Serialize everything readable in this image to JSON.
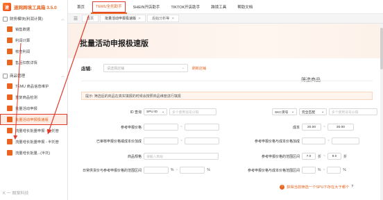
{
  "app": {
    "title": "速网跨境工具箱 3.5.0",
    "logo_char": "速"
  },
  "sidebar": {
    "groups": [
      {
        "label": "财务模块(利润计算)",
        "items": [
          {
            "label": "销售数据"
          },
          {
            "label": "利润计算"
          },
          {
            "label": "核查利润"
          },
          {
            "label": "售后扣款详情"
          }
        ]
      },
      {
        "label": "商品管理",
        "items": [
          {
            "label": "TEMU 商品信息维护"
          },
          {
            "label": "重复商品检测"
          },
          {
            "label": "批量活动申报"
          },
          {
            "label": "批量活动申报极速版",
            "active": true
          },
          {
            "label": "流量增长批量申报 - 全托管"
          },
          {
            "label": "流量增长批量申报 - 半托管"
          },
          {
            "label": "流量增长批量...(半托)"
          }
        ]
      }
    ],
    "footer": "K 一 图案科技"
  },
  "topnav": {
    "tabs": [
      {
        "label": "首页"
      },
      {
        "label": "TEMU全托助手",
        "active": true
      },
      {
        "label": "SHEIN开店助手"
      },
      {
        "label": "TIKTOK开店助手"
      },
      {
        "label": "跨境工具"
      },
      {
        "label": "帮助文档"
      }
    ]
  },
  "tabstrip": {
    "tabs": [
      {
        "label": "首页"
      },
      {
        "label": "批量活动申报极速版",
        "active": true
      },
      {
        "label": "后始分析等"
      }
    ]
  },
  "page": {
    "title": "批量活动申报极速版",
    "store_label": "店铺:",
    "store_placeholder": "请选择店铺",
    "store_link": "刷新店铺",
    "section_title": "筛选商品",
    "tip": "提示: 筛选后的商品在真实填报的时候会按照商品维度进行填报"
  },
  "filters": {
    "id_query_label": "ID 查询",
    "id_type": "SPU ID",
    "id_placeholder": "多个使用逗号分隔",
    "skc_type": "SKC货号",
    "match_mode": "完全匹配",
    "skc_placeholder": "多个使用逗号分隔",
    "ref_price_label": "参考申报价格",
    "cost_label": "成本",
    "cost_min": "20.00",
    "cost_max": "30.00",
    "declared_ratio_label": "已审核申报价格或成本价加成",
    "ref_ratio_label": "参考申报价格与成本价格加成",
    "spec_label": "商品规格",
    "spec_placeholder": "请输入商规",
    "discount_label": "参考申报价格的范围区间",
    "discount_min": "7.0",
    "discount_max": "9.0",
    "discount_unit": "折",
    "sold_ratio_label": "日常供货价与参考申报价格的范围区间",
    "percent": "%",
    "cost_pct_label": "参考申报价格与成本价格范围区间",
    "range_sep": "~"
  },
  "footer_note": {
    "text": "获得当前筛选一个SPU下存在大于哪个",
    "q": "?"
  }
}
